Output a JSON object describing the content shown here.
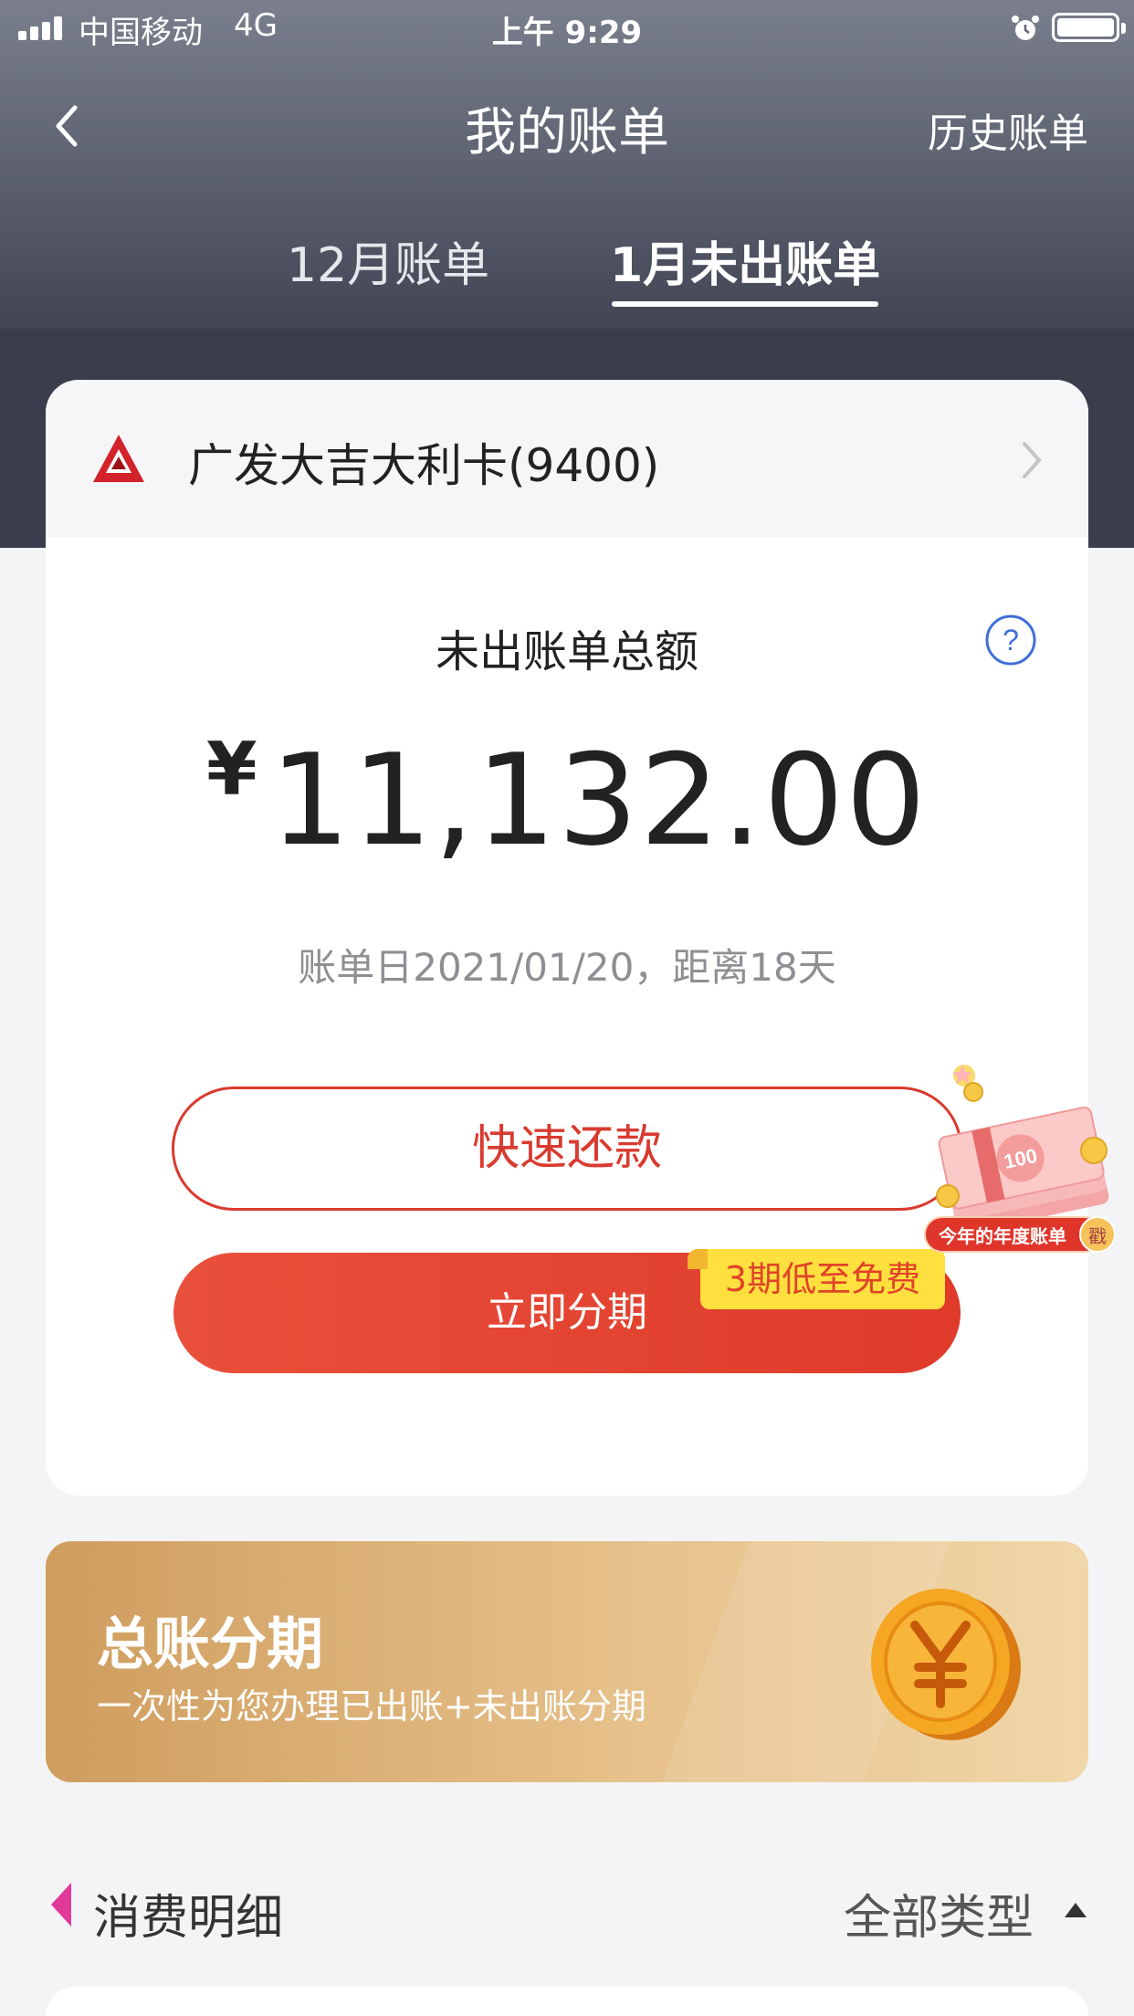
{
  "status_bar": {
    "carrier": "中国移动",
    "network": "4G",
    "time": "上午 9:29"
  },
  "nav": {
    "title": "我的账单",
    "history_link": "历史账单"
  },
  "tabs": [
    {
      "label": "12月账单",
      "active": false
    },
    {
      "label": "1月未出账单",
      "active": true
    }
  ],
  "card": {
    "name": "广发大吉大利卡(9400)",
    "unbilled_label": "未出账单总额",
    "currency": "¥",
    "amount": "11,132.00",
    "bill_date": "账单日2021/01/20，距离18天",
    "repay_button": "快速还款",
    "installment_button": "立即分期",
    "promo_tag": "3期低至免费"
  },
  "annual_widget": {
    "label": "今年的年度账单",
    "stamp": "戳",
    "note_value": "100"
  },
  "banner": {
    "title": "总账分期",
    "subtitle": "一次性为您办理已出账+未出账分期"
  },
  "details": {
    "title": "消费明细",
    "filter": "全部类型"
  },
  "colors": {
    "accent_red": "#d93a2f",
    "promo_yellow": "#ffe03e",
    "banner_gold": "#cf9d5e",
    "section_marker": "#e0399a"
  }
}
